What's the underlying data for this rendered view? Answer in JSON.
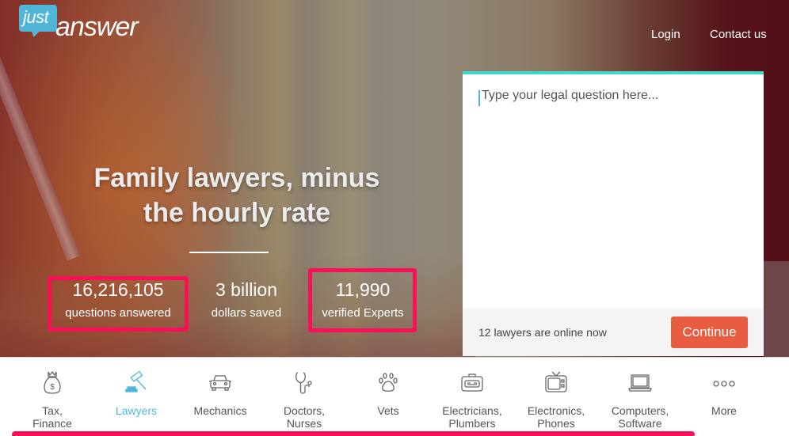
{
  "brand": {
    "logo_just": "just",
    "logo_answer": "answer",
    "accent_color": "#4fb6d9",
    "cta_color": "#e85c41",
    "highlight_color": "#fa1057",
    "card_topline_color": "#3fd8cd"
  },
  "nav": {
    "login": "Login",
    "contact": "Contact us"
  },
  "hero": {
    "headline_line1": "Family lawyers, minus",
    "headline_line2": "the hourly rate",
    "stats": [
      {
        "value": "16,216,105",
        "label": "questions answered",
        "highlighted": true
      },
      {
        "value": "3 billion",
        "label": "dollars saved",
        "highlighted": false
      },
      {
        "value": "11,990",
        "label": "verified Experts",
        "highlighted": true
      }
    ]
  },
  "question_card": {
    "placeholder": "Type your legal question here...",
    "value": "",
    "online_status": "12 lawyers are online now",
    "continue_label": "Continue"
  },
  "categories": [
    {
      "label": "Tax, Finance",
      "icon": "money-bag-icon",
      "active": false
    },
    {
      "label": "Lawyers",
      "icon": "gavel-icon",
      "active": true
    },
    {
      "label": "Mechanics",
      "icon": "car-icon",
      "active": false
    },
    {
      "label": "Doctors, Nurses",
      "icon": "stethoscope-icon",
      "active": false
    },
    {
      "label": "Vets",
      "icon": "paw-icon",
      "active": false
    },
    {
      "label": "Electricians, Plumbers",
      "icon": "toolbox-icon",
      "active": false
    },
    {
      "label": "Electronics, Phones",
      "icon": "tv-icon",
      "active": false
    },
    {
      "label": "Computers, Software",
      "icon": "laptop-icon",
      "active": false
    },
    {
      "label": "More",
      "icon": "more-dots-icon",
      "active": false
    }
  ]
}
